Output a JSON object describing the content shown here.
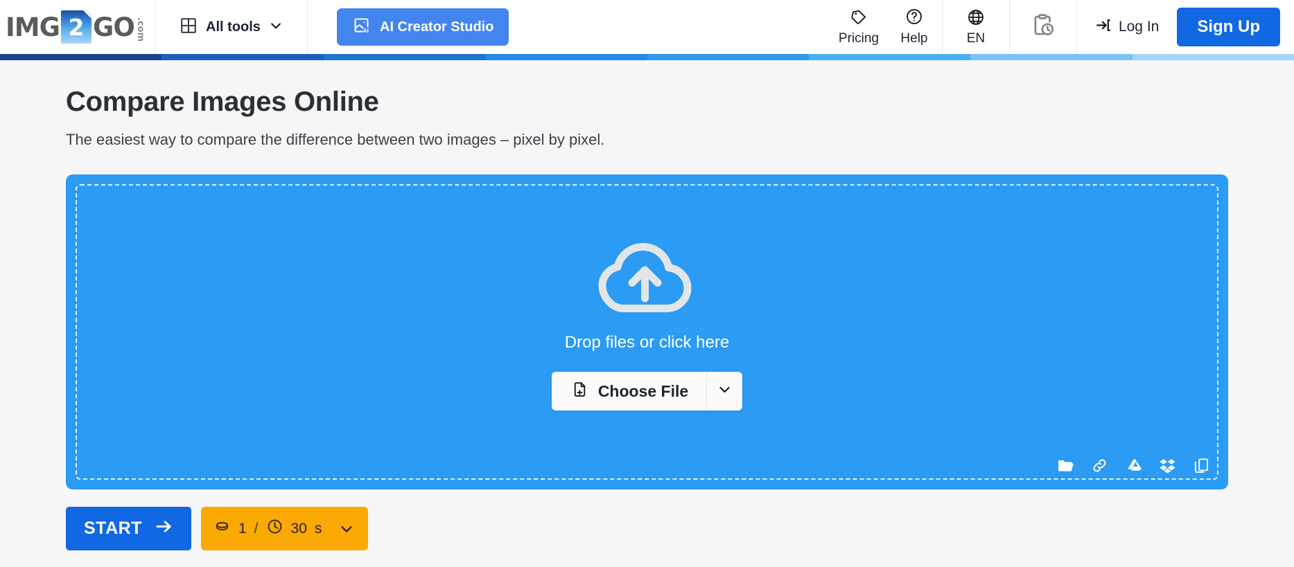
{
  "brand": {
    "logo_left": "IMG",
    "logo_tile": "2",
    "logo_right": "GO",
    "logo_domain": ".com"
  },
  "header": {
    "all_tools": {
      "label": "All tools",
      "icon": "grid-icon",
      "chevron": "chevron-down-icon"
    },
    "ai_studio": {
      "label": "AI Creator Studio",
      "icon": "ai-image-icon",
      "color": "#4285ef"
    },
    "pricing": {
      "label": "Pricing",
      "icon": "price-tag-icon"
    },
    "help": {
      "label": "Help",
      "icon": "question-circle-icon"
    },
    "language": {
      "label": "EN",
      "icon": "globe-icon"
    },
    "history": {
      "icon": "clipboard-clock-icon"
    },
    "login": {
      "label": "Log In",
      "icon": "login-arrow-icon"
    },
    "signup": {
      "label": "Sign Up",
      "color": "#1268e3"
    }
  },
  "stripe": {
    "colors": [
      "#1b438f",
      "#1c5fc0",
      "#1f74d4",
      "#2489e8",
      "#2e9bf2",
      "#4aaef5",
      "#79c3f8",
      "#a3d6fb"
    ]
  },
  "main": {
    "title": "Compare Images Online",
    "subtitle": "The easiest way to compare the difference between two images – pixel by pixel."
  },
  "dropzone": {
    "cloud_icon": "cloud-upload-icon",
    "drop_label": "Drop files or click here",
    "choose_file_label": "Choose File",
    "choose_file_icon": "file-add-icon",
    "choose_file_chevron": "chevron-down-icon",
    "background": "#2b9bf4",
    "sources": [
      {
        "name": "folder-icon"
      },
      {
        "name": "link-icon"
      },
      {
        "name": "google-drive-icon"
      },
      {
        "name": "dropbox-icon"
      },
      {
        "name": "copy-icon"
      }
    ]
  },
  "actions": {
    "start_label": "START",
    "start_icon": "arrow-right-icon",
    "start_color": "#1268e3",
    "credits": {
      "coin_icon": "coin-icon",
      "count": "1",
      "separator": "/",
      "clock_icon": "clock-icon",
      "time_value": "30",
      "time_unit": "s",
      "chevron": "chevron-down-icon",
      "color": "#fba904"
    }
  }
}
